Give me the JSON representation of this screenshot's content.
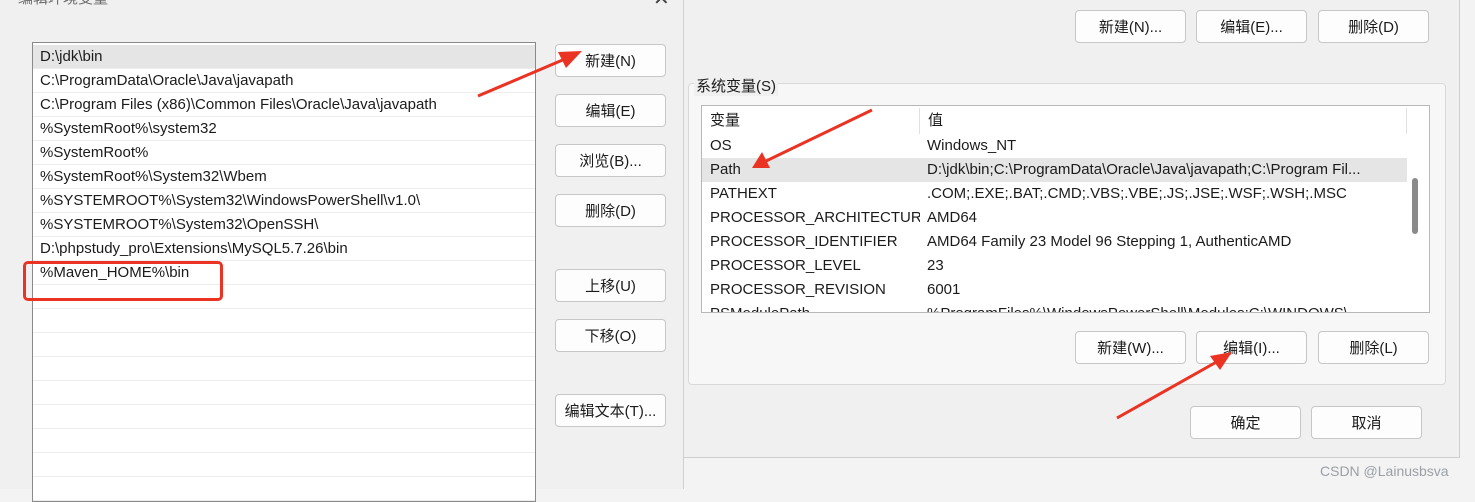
{
  "edit_dialog": {
    "title": "编辑环境变量",
    "close_glyph": "✕",
    "path_entries": [
      "D:\\jdk\\bin",
      "C:\\ProgramData\\Oracle\\Java\\javapath",
      "C:\\Program Files (x86)\\Common Files\\Oracle\\Java\\javapath",
      "%SystemRoot%\\system32",
      "%SystemRoot%",
      "%SystemRoot%\\System32\\Wbem",
      "%SYSTEMROOT%\\System32\\WindowsPowerShell\\v1.0\\",
      "%SYSTEMROOT%\\System32\\OpenSSH\\",
      "D:\\phpstudy_pro\\Extensions\\MySQL5.7.26\\bin",
      "%Maven_HOME%\\bin"
    ],
    "selected_index": 0,
    "buttons": {
      "new": "新建(N)",
      "edit": "编辑(E)",
      "browse": "浏览(B)...",
      "delete": "删除(D)",
      "move_up": "上移(U)",
      "move_down": "下移(O)",
      "edit_text": "编辑文本(T)..."
    }
  },
  "env_dialog": {
    "user_buttons": {
      "new": "新建(N)...",
      "edit": "编辑(E)...",
      "delete": "删除(D)"
    },
    "system_group_label": "系统变量(S)",
    "table": {
      "columns": [
        "变量",
        "值"
      ],
      "rows": [
        {
          "name": "OS",
          "value": "Windows_NT"
        },
        {
          "name": "Path",
          "value": "D:\\jdk\\bin;C:\\ProgramData\\Oracle\\Java\\javapath;C:\\Program Fil..."
        },
        {
          "name": "PATHEXT",
          "value": ".COM;.EXE;.BAT;.CMD;.VBS;.VBE;.JS;.JSE;.WSF;.WSH;.MSC"
        },
        {
          "name": "PROCESSOR_ARCHITECTURE",
          "value": "AMD64"
        },
        {
          "name": "PROCESSOR_IDENTIFIER",
          "value": "AMD64 Family 23 Model 96 Stepping 1, AuthenticAMD"
        },
        {
          "name": "PROCESSOR_LEVEL",
          "value": "23"
        },
        {
          "name": "PROCESSOR_REVISION",
          "value": "6001"
        },
        {
          "name": "PSModulePath",
          "value": "%ProgramFiles%\\WindowsPowerShell\\Modules;C:\\WINDOWS\\..."
        }
      ],
      "selected_index": 1
    },
    "system_buttons": {
      "new": "新建(W)...",
      "edit": "编辑(I)...",
      "delete": "删除(L)"
    },
    "ok": "确定",
    "cancel": "取消"
  },
  "annotations": {
    "arrow_color": "#ea3323",
    "highlight_color": "#ea3323"
  },
  "watermark": "CSDN @Lainusbsva"
}
